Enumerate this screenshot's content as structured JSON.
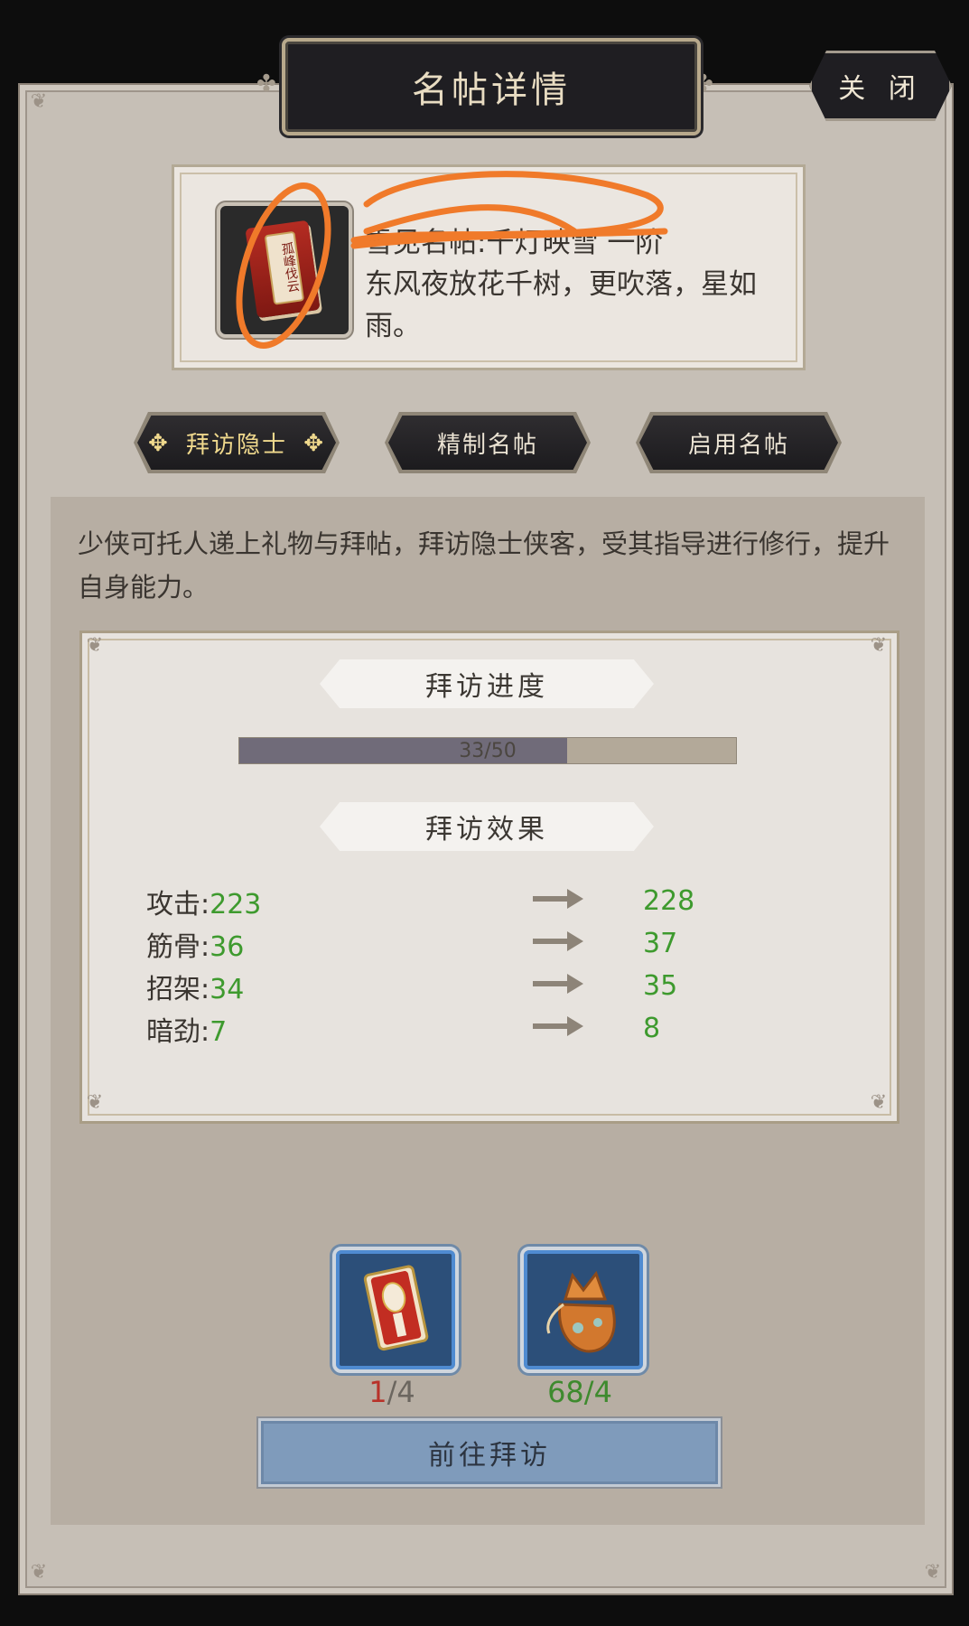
{
  "header": {
    "title": "名帖详情",
    "close_label": "关 闭"
  },
  "item": {
    "icon_name": "card-scroll-icon",
    "name_line": "雪见名帖:千灯映雪",
    "rank": "一阶",
    "desc_lines": [
      "东风夜放花千树，更吹落，星如",
      "雨。"
    ],
    "badge_text": "孤峰伐云"
  },
  "tabs": [
    {
      "label": "拜访隐士",
      "active": true
    },
    {
      "label": "精制名帖",
      "active": false
    },
    {
      "label": "启用名帖",
      "active": false
    }
  ],
  "description": "少侠可托人递上礼物与拜帖，拜访隐士侠客，受其指导进行修行，提升自身能力。",
  "progress": {
    "heading": "拜访进度",
    "current": 33,
    "max": 50,
    "label": "33/50"
  },
  "effects": {
    "heading": "拜访效果",
    "stats": [
      {
        "name": "攻击:",
        "old": "223",
        "new": "228"
      },
      {
        "name": "筋骨:",
        "old": "36",
        "new": "37"
      },
      {
        "name": "招架:",
        "old": "34",
        "new": "35"
      },
      {
        "name": "暗劲:",
        "old": "7",
        "new": "8"
      }
    ]
  },
  "costs": [
    {
      "icon_name": "visit-card-icon",
      "have": "1",
      "sep": "/",
      "need": "4",
      "sufficient": false
    },
    {
      "icon_name": "gift-pouch-icon",
      "have": "68",
      "sep": "/",
      "need": "4",
      "sufficient": true
    }
  ],
  "action": {
    "go_label": "前往拜访"
  },
  "colors": {
    "panel_bg": "#c6bfb6",
    "dark_plate": "#1f1e22",
    "green_value": "#3e9a2e",
    "red_value": "#b8322a",
    "action_blue": "#7f9bbb",
    "annotation_orange": "#f07a2a"
  }
}
